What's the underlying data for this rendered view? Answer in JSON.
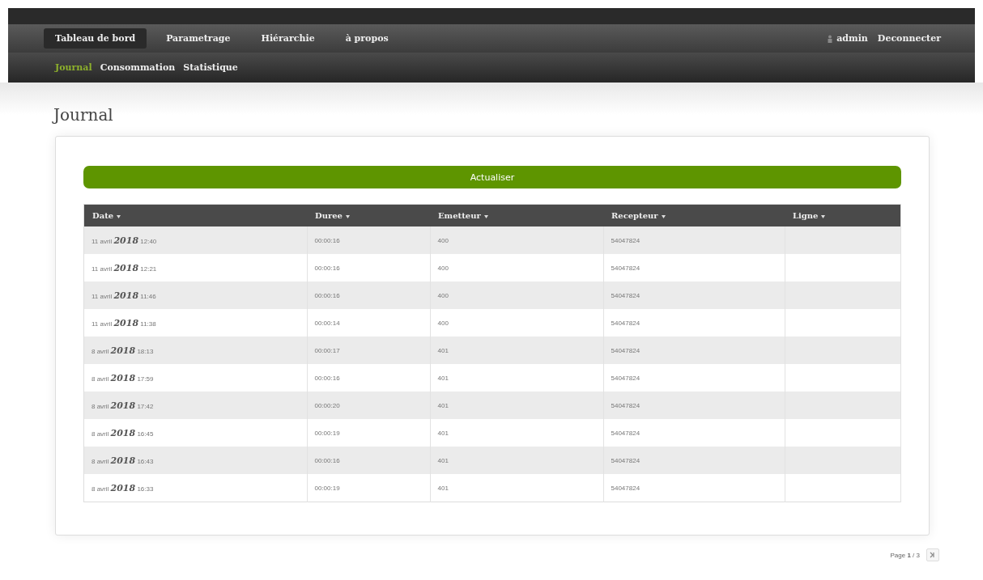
{
  "nav": {
    "tabs": [
      {
        "label": "Tableau de bord",
        "selected": true
      },
      {
        "label": "Parametrage",
        "selected": false
      },
      {
        "label": "Hiérarchie",
        "selected": false
      },
      {
        "label": "à propos",
        "selected": false
      }
    ],
    "user": "admin",
    "logout": "Deconnecter",
    "subtabs": [
      {
        "label": "Journal",
        "selected": true
      },
      {
        "label": "Consommation",
        "selected": false
      },
      {
        "label": "Statistique",
        "selected": false
      }
    ]
  },
  "heading": "Journal",
  "refresh_button": "Actualiser",
  "table": {
    "columns": [
      "Date",
      "Duree",
      "Emetteur",
      "Recepteur",
      "Ligne"
    ],
    "rows": [
      [
        "11 avril **2018** 12:40",
        "00:00:16",
        "400",
        "54047824",
        ""
      ],
      [
        "11 avril **2018** 12:21",
        "00:00:16",
        "400",
        "54047824",
        ""
      ],
      [
        "11 avril **2018** 11:46",
        "00:00:16",
        "400",
        "54047824",
        ""
      ],
      [
        "11 avril **2018** 11:38",
        "00:00:14",
        "400",
        "54047824",
        ""
      ],
      [
        "8 avril **2018** 18:13",
        "00:00:17",
        "401",
        "54047824",
        ""
      ],
      [
        "8 avril **2018** 17:59",
        "00:00:16",
        "401",
        "54047824",
        ""
      ],
      [
        "8 avril **2018** 17:42",
        "00:00:20",
        "401",
        "54047824",
        ""
      ],
      [
        "8 avril **2018** 16:45",
        "00:00:19",
        "401",
        "54047824",
        ""
      ],
      [
        "8 avril **2018** 16:43",
        "00:00:16",
        "401",
        "54047824",
        ""
      ],
      [
        "8 avril **2018** 16:33",
        "00:00:19",
        "401",
        "54047824",
        ""
      ]
    ]
  },
  "pagination": {
    "label": "Page **1** / 3"
  }
}
